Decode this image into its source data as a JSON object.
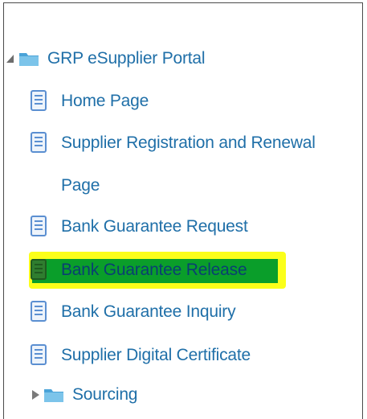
{
  "tree": {
    "root": {
      "label": "GRP eSupplier Portal",
      "icon": "folder-icon",
      "expanded": true
    },
    "items": [
      {
        "label": "Home Page",
        "icon": "document-icon"
      },
      {
        "label": "Supplier Registration and Renewal",
        "label_cont": "Page",
        "icon": "document-icon"
      },
      {
        "label": "Bank Guarantee Request",
        "icon": "document-icon"
      },
      {
        "label": "Bank Guarantee Release",
        "icon": "document-icon",
        "highlighted": true
      },
      {
        "label": "Bank Guarantee Inquiry",
        "icon": "document-icon"
      },
      {
        "label": "Supplier Digital Certificate",
        "icon": "document-icon"
      }
    ],
    "sub_folder": {
      "label": "Sourcing",
      "icon": "folder-icon",
      "expanded": false
    }
  },
  "colors": {
    "link": "#1f6fa8",
    "highlight": "#fbff1a",
    "selected": "#0a9e2a",
    "folder": "#4aa3d8",
    "doc": "#5b8fd1"
  }
}
